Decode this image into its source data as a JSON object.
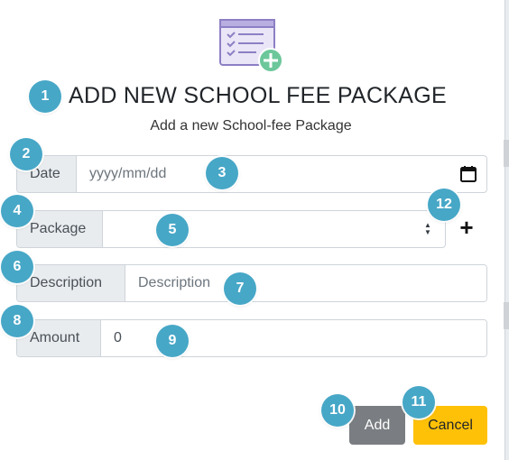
{
  "modal": {
    "title": "ADD NEW SCHOOL FEE PACKAGE",
    "subtitle": "Add a new School-fee Package",
    "header_icon": "checklist-add-icon"
  },
  "form": {
    "date": {
      "label": "Date",
      "placeholder": "yyyy/mm/dd",
      "icon": "calendar-icon"
    },
    "package": {
      "label": "Package",
      "value": "",
      "add_icon": "plus-icon"
    },
    "description": {
      "label": "Description",
      "placeholder": "Description"
    },
    "amount": {
      "label": "Amount",
      "value": "0"
    }
  },
  "buttons": {
    "add": "Add",
    "cancel": "Cancel"
  },
  "badges": [
    "1",
    "2",
    "3",
    "4",
    "5",
    "6",
    "7",
    "8",
    "9",
    "10",
    "11",
    "12"
  ],
  "colors": {
    "badge": "#47a7c7",
    "add_button": "#7a7e82",
    "cancel_button": "#ffc107",
    "addon_bg": "#e9ecef"
  }
}
